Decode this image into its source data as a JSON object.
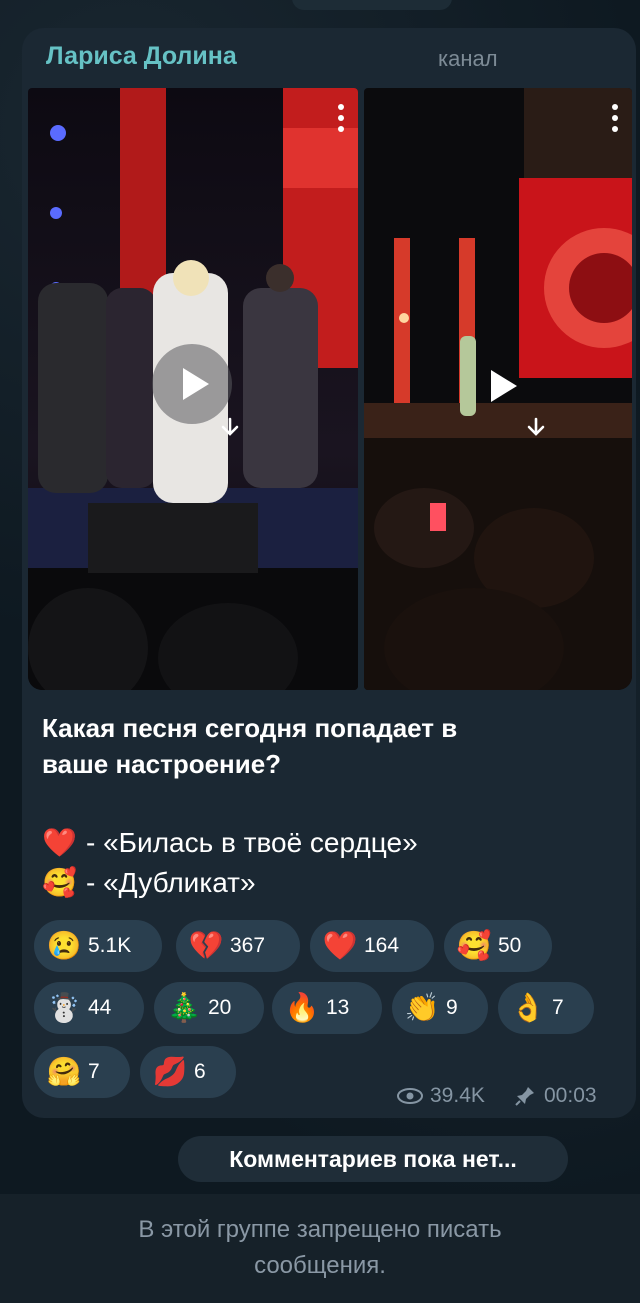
{
  "channel": {
    "name": "Лариса Долина",
    "tag": "канал"
  },
  "post": {
    "text_line1": "Какая песня сегодня попадает в",
    "text_line2": "ваше настроение?",
    "options": [
      {
        "emoji": "❤️",
        "text": "- «Билась в твоё сердце»"
      },
      {
        "emoji": "🥰",
        "text": "- «Дубликат»"
      }
    ]
  },
  "reactions": [
    {
      "emoji": "😢",
      "count": "5.1K"
    },
    {
      "emoji": "💔",
      "count": "367"
    },
    {
      "emoji": "❤️",
      "count": "164"
    },
    {
      "emoji": "🥰",
      "count": "50"
    },
    {
      "emoji": "☃️",
      "count": "44"
    },
    {
      "emoji": "🎄",
      "count": "20"
    },
    {
      "emoji": "🔥",
      "count": "13"
    },
    {
      "emoji": "👏",
      "count": "9"
    },
    {
      "emoji": "👌",
      "count": "7"
    },
    {
      "emoji": "🤗",
      "count": "7"
    },
    {
      "emoji": "💋",
      "count": "6"
    }
  ],
  "meta": {
    "views": "39.4K",
    "time": "00:03"
  },
  "comments_label": "Комментариев пока нет...",
  "bottom_notice_line1": "В этой группе запрещено писать",
  "bottom_notice_line2": "сообщения."
}
